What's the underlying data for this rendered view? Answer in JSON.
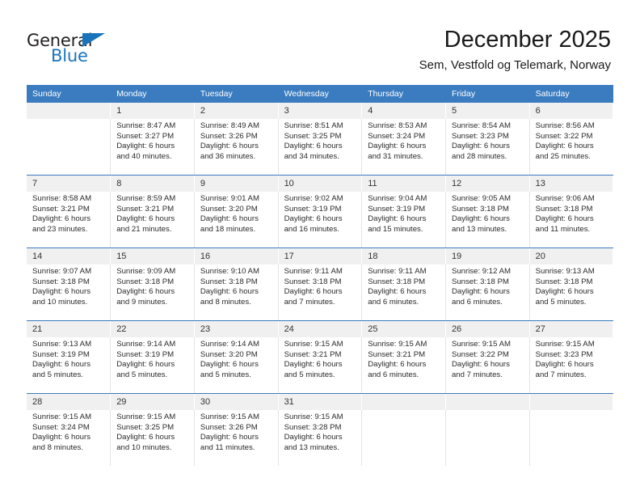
{
  "brand": {
    "name_top": "General",
    "name_bottom": "Blue",
    "triangle_icon": "triangle-icon",
    "accent_color": "#1a74bb"
  },
  "header": {
    "title": "December 2025",
    "subtitle": "Sem, Vestfold og Telemark, Norway"
  },
  "theme": {
    "header_blue": "#3b7cc0",
    "daynum_band": "#f0f0f0",
    "text": "#2b2b2b"
  },
  "weekday_headers": [
    "Sunday",
    "Monday",
    "Tuesday",
    "Wednesday",
    "Thursday",
    "Friday",
    "Saturday"
  ],
  "weeks": [
    {
      "days": [
        {
          "day": "",
          "sunrise": "",
          "sunset": "",
          "daylight_1": "",
          "daylight_2": ""
        },
        {
          "day": "1",
          "sunrise": "Sunrise: 8:47 AM",
          "sunset": "Sunset: 3:27 PM",
          "daylight_1": "Daylight: 6 hours",
          "daylight_2": "and 40 minutes."
        },
        {
          "day": "2",
          "sunrise": "Sunrise: 8:49 AM",
          "sunset": "Sunset: 3:26 PM",
          "daylight_1": "Daylight: 6 hours",
          "daylight_2": "and 36 minutes."
        },
        {
          "day": "3",
          "sunrise": "Sunrise: 8:51 AM",
          "sunset": "Sunset: 3:25 PM",
          "daylight_1": "Daylight: 6 hours",
          "daylight_2": "and 34 minutes."
        },
        {
          "day": "4",
          "sunrise": "Sunrise: 8:53 AM",
          "sunset": "Sunset: 3:24 PM",
          "daylight_1": "Daylight: 6 hours",
          "daylight_2": "and 31 minutes."
        },
        {
          "day": "5",
          "sunrise": "Sunrise: 8:54 AM",
          "sunset": "Sunset: 3:23 PM",
          "daylight_1": "Daylight: 6 hours",
          "daylight_2": "and 28 minutes."
        },
        {
          "day": "6",
          "sunrise": "Sunrise: 8:56 AM",
          "sunset": "Sunset: 3:22 PM",
          "daylight_1": "Daylight: 6 hours",
          "daylight_2": "and 25 minutes."
        }
      ]
    },
    {
      "days": [
        {
          "day": "7",
          "sunrise": "Sunrise: 8:58 AM",
          "sunset": "Sunset: 3:21 PM",
          "daylight_1": "Daylight: 6 hours",
          "daylight_2": "and 23 minutes."
        },
        {
          "day": "8",
          "sunrise": "Sunrise: 8:59 AM",
          "sunset": "Sunset: 3:21 PM",
          "daylight_1": "Daylight: 6 hours",
          "daylight_2": "and 21 minutes."
        },
        {
          "day": "9",
          "sunrise": "Sunrise: 9:01 AM",
          "sunset": "Sunset: 3:20 PM",
          "daylight_1": "Daylight: 6 hours",
          "daylight_2": "and 18 minutes."
        },
        {
          "day": "10",
          "sunrise": "Sunrise: 9:02 AM",
          "sunset": "Sunset: 3:19 PM",
          "daylight_1": "Daylight: 6 hours",
          "daylight_2": "and 16 minutes."
        },
        {
          "day": "11",
          "sunrise": "Sunrise: 9:04 AM",
          "sunset": "Sunset: 3:19 PM",
          "daylight_1": "Daylight: 6 hours",
          "daylight_2": "and 15 minutes."
        },
        {
          "day": "12",
          "sunrise": "Sunrise: 9:05 AM",
          "sunset": "Sunset: 3:18 PM",
          "daylight_1": "Daylight: 6 hours",
          "daylight_2": "and 13 minutes."
        },
        {
          "day": "13",
          "sunrise": "Sunrise: 9:06 AM",
          "sunset": "Sunset: 3:18 PM",
          "daylight_1": "Daylight: 6 hours",
          "daylight_2": "and 11 minutes."
        }
      ]
    },
    {
      "days": [
        {
          "day": "14",
          "sunrise": "Sunrise: 9:07 AM",
          "sunset": "Sunset: 3:18 PM",
          "daylight_1": "Daylight: 6 hours",
          "daylight_2": "and 10 minutes."
        },
        {
          "day": "15",
          "sunrise": "Sunrise: 9:09 AM",
          "sunset": "Sunset: 3:18 PM",
          "daylight_1": "Daylight: 6 hours",
          "daylight_2": "and 9 minutes."
        },
        {
          "day": "16",
          "sunrise": "Sunrise: 9:10 AM",
          "sunset": "Sunset: 3:18 PM",
          "daylight_1": "Daylight: 6 hours",
          "daylight_2": "and 8 minutes."
        },
        {
          "day": "17",
          "sunrise": "Sunrise: 9:11 AM",
          "sunset": "Sunset: 3:18 PM",
          "daylight_1": "Daylight: 6 hours",
          "daylight_2": "and 7 minutes."
        },
        {
          "day": "18",
          "sunrise": "Sunrise: 9:11 AM",
          "sunset": "Sunset: 3:18 PM",
          "daylight_1": "Daylight: 6 hours",
          "daylight_2": "and 6 minutes."
        },
        {
          "day": "19",
          "sunrise": "Sunrise: 9:12 AM",
          "sunset": "Sunset: 3:18 PM",
          "daylight_1": "Daylight: 6 hours",
          "daylight_2": "and 6 minutes."
        },
        {
          "day": "20",
          "sunrise": "Sunrise: 9:13 AM",
          "sunset": "Sunset: 3:18 PM",
          "daylight_1": "Daylight: 6 hours",
          "daylight_2": "and 5 minutes."
        }
      ]
    },
    {
      "days": [
        {
          "day": "21",
          "sunrise": "Sunrise: 9:13 AM",
          "sunset": "Sunset: 3:19 PM",
          "daylight_1": "Daylight: 6 hours",
          "daylight_2": "and 5 minutes."
        },
        {
          "day": "22",
          "sunrise": "Sunrise: 9:14 AM",
          "sunset": "Sunset: 3:19 PM",
          "daylight_1": "Daylight: 6 hours",
          "daylight_2": "and 5 minutes."
        },
        {
          "day": "23",
          "sunrise": "Sunrise: 9:14 AM",
          "sunset": "Sunset: 3:20 PM",
          "daylight_1": "Daylight: 6 hours",
          "daylight_2": "and 5 minutes."
        },
        {
          "day": "24",
          "sunrise": "Sunrise: 9:15 AM",
          "sunset": "Sunset: 3:21 PM",
          "daylight_1": "Daylight: 6 hours",
          "daylight_2": "and 5 minutes."
        },
        {
          "day": "25",
          "sunrise": "Sunrise: 9:15 AM",
          "sunset": "Sunset: 3:21 PM",
          "daylight_1": "Daylight: 6 hours",
          "daylight_2": "and 6 minutes."
        },
        {
          "day": "26",
          "sunrise": "Sunrise: 9:15 AM",
          "sunset": "Sunset: 3:22 PM",
          "daylight_1": "Daylight: 6 hours",
          "daylight_2": "and 7 minutes."
        },
        {
          "day": "27",
          "sunrise": "Sunrise: 9:15 AM",
          "sunset": "Sunset: 3:23 PM",
          "daylight_1": "Daylight: 6 hours",
          "daylight_2": "and 7 minutes."
        }
      ]
    },
    {
      "days": [
        {
          "day": "28",
          "sunrise": "Sunrise: 9:15 AM",
          "sunset": "Sunset: 3:24 PM",
          "daylight_1": "Daylight: 6 hours",
          "daylight_2": "and 8 minutes."
        },
        {
          "day": "29",
          "sunrise": "Sunrise: 9:15 AM",
          "sunset": "Sunset: 3:25 PM",
          "daylight_1": "Daylight: 6 hours",
          "daylight_2": "and 10 minutes."
        },
        {
          "day": "30",
          "sunrise": "Sunrise: 9:15 AM",
          "sunset": "Sunset: 3:26 PM",
          "daylight_1": "Daylight: 6 hours",
          "daylight_2": "and 11 minutes."
        },
        {
          "day": "31",
          "sunrise": "Sunrise: 9:15 AM",
          "sunset": "Sunset: 3:28 PM",
          "daylight_1": "Daylight: 6 hours",
          "daylight_2": "and 13 minutes."
        },
        {
          "day": "",
          "sunrise": "",
          "sunset": "",
          "daylight_1": "",
          "daylight_2": ""
        },
        {
          "day": "",
          "sunrise": "",
          "sunset": "",
          "daylight_1": "",
          "daylight_2": ""
        },
        {
          "day": "",
          "sunrise": "",
          "sunset": "",
          "daylight_1": "",
          "daylight_2": ""
        }
      ]
    }
  ]
}
